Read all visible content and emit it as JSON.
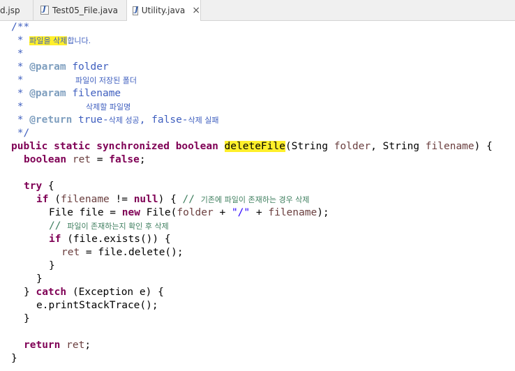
{
  "tabs": [
    {
      "label": "d.jsp"
    },
    {
      "label": "Test05_File.java"
    },
    {
      "label": "Utility.java",
      "close": "×"
    }
  ],
  "code": {
    "l1": "/**",
    "l2_star": " * ",
    "l2_hl": "파일을 삭제",
    "l2_rest": "합니다.",
    "l3": " *",
    "l4_star": " * ",
    "l4_tag": "@param",
    "l4_name": " folder",
    "l5_star": " *",
    "l5_desc": "파일이 저장된 폴더",
    "l6_star": " * ",
    "l6_tag": "@param",
    "l6_name": " filename",
    "l7_star": " *",
    "l7_desc": "삭제할 파일명",
    "l8_star": " * ",
    "l8_tag": "@return",
    "l8_t1": " true-",
    "l8_k1": "삭제 성공",
    "l8_t2": ", false-",
    "l8_k2": "삭제 실패",
    "l9": " */",
    "l10_kw": "public static synchronized boolean",
    "l10_method": "deleteFile",
    "l10_p1": "(String ",
    "l10_f1": "folder",
    "l10_p2": ", String ",
    "l10_f2": "filename",
    "l10_p3": ") {",
    "l11_kw": "boolean",
    "l11_var": " ret",
    "l11_eq": " = ",
    "l11_val": "false",
    "l11_end": ";",
    "l13_kw": "try",
    "l13_end": " {",
    "l14_kw": "if",
    "l14_p1": " (",
    "l14_f": "filename",
    "l14_p2": " != ",
    "l14_null": "null",
    "l14_p3": ") { ",
    "l14_cm": "// ",
    "l14_ko": "기존에 파일이 존재하는 경우 삭제",
    "l15_p1": "File file = ",
    "l15_new": "new",
    "l15_p2": " File(",
    "l15_f": "folder",
    "l15_p3": " + ",
    "l15_str": "\"/\"",
    "l15_p4": " + ",
    "l15_f2": "filename",
    "l15_p5": ");",
    "l16_cm": "// ",
    "l16_ko": "파일이 존재하는지 확인 후 삭제",
    "l17_kw": "if",
    "l17_rest": " (file.exists()) {",
    "l18_var": "ret",
    "l18_rest": " = file.delete();",
    "l19": "}",
    "l20": "}",
    "l21_p1": "} ",
    "l21_kw": "catch",
    "l21_p2": " (Exception e) {",
    "l22": "e.printStackTrace();",
    "l23": "}",
    "l25_kw": "return",
    "l25_var": " ret",
    "l25_end": ";",
    "l26": "}"
  }
}
